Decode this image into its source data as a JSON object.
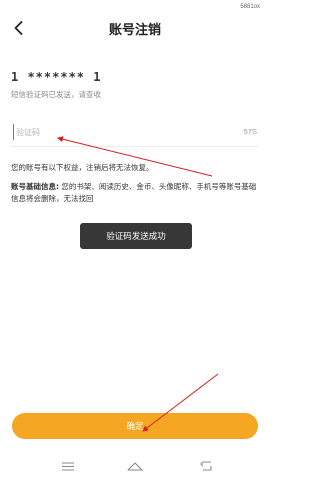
{
  "status_bar": {
    "right_text": "5881ox"
  },
  "header": {
    "title": "账号注销",
    "back_icon": "chevron-left-icon"
  },
  "phone_masked": "1 ******* 1",
  "sms_hint": "短信验证码已发送，请查收",
  "code_field": {
    "placeholder": "验证码",
    "value": "",
    "countdown": "57S"
  },
  "notice": {
    "main": "您的账号有以下权益，注销后将无法恢复。",
    "info_label": "账号基础信息:",
    "info_text": " 您的书架、阅读历史、金币、头像昵称、手机号等账号基础信息将会删除，无法找回"
  },
  "toast": "验证码发送成功",
  "confirm_button": "确定",
  "nav": {
    "menu_icon": "menu-icon",
    "home_icon": "home-icon",
    "back_icon": "back-icon"
  },
  "colors": {
    "accent": "#f5a623",
    "annotation": "#d81e1e",
    "cursor": "#2f8fbd"
  }
}
